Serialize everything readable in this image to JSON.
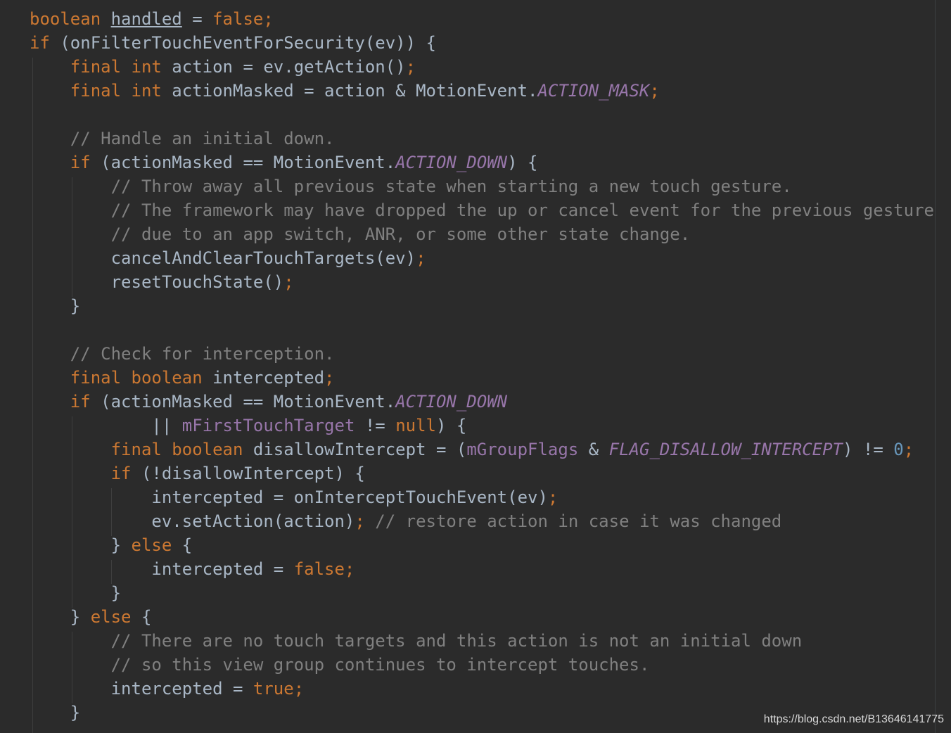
{
  "editor": {
    "background": "#2b2b2b",
    "theme_colors": {
      "keyword": "#cc7832",
      "plain": "#a9b7c6",
      "comment": "#808080",
      "constant": "#9876aa",
      "number": "#6897bb"
    },
    "lines": [
      {
        "indent": 0,
        "tokens": [
          {
            "t": "kw",
            "v": "boolean "
          },
          {
            "t": "ul",
            "v": "handled"
          },
          {
            "t": "pl",
            "v": " = "
          },
          {
            "t": "kw",
            "v": "false;"
          }
        ]
      },
      {
        "indent": 0,
        "tokens": [
          {
            "t": "kw",
            "v": "if "
          },
          {
            "t": "pl",
            "v": "(onFilterTouchEventForSecurity(ev)) {"
          }
        ]
      },
      {
        "indent": 1,
        "tokens": [
          {
            "t": "kw",
            "v": "final int "
          },
          {
            "t": "pl",
            "v": "action = ev.getAction()"
          },
          {
            "t": "kw",
            "v": ";"
          }
        ]
      },
      {
        "indent": 1,
        "tokens": [
          {
            "t": "kw",
            "v": "final int "
          },
          {
            "t": "pl",
            "v": "actionMasked = action & MotionEvent."
          },
          {
            "t": "cn",
            "v": "ACTION_MASK"
          },
          {
            "t": "kw",
            "v": ";"
          }
        ]
      },
      {
        "indent": 0,
        "tokens": []
      },
      {
        "indent": 1,
        "tokens": [
          {
            "t": "cm",
            "v": "// Handle an initial down."
          }
        ]
      },
      {
        "indent": 1,
        "tokens": [
          {
            "t": "kw",
            "v": "if "
          },
          {
            "t": "pl",
            "v": "(actionMasked == MotionEvent."
          },
          {
            "t": "cn",
            "v": "ACTION_DOWN"
          },
          {
            "t": "pl",
            "v": ") {"
          }
        ]
      },
      {
        "indent": 2,
        "tokens": [
          {
            "t": "cm",
            "v": "// Throw away all previous state when starting a new touch gesture."
          }
        ]
      },
      {
        "indent": 2,
        "tokens": [
          {
            "t": "cm",
            "v": "// The framework may have dropped the up or cancel event for the previous gesture"
          }
        ]
      },
      {
        "indent": 2,
        "tokens": [
          {
            "t": "cm",
            "v": "// due to an app switch, ANR, or some other state change."
          }
        ]
      },
      {
        "indent": 2,
        "tokens": [
          {
            "t": "pl",
            "v": "cancelAndClearTouchTargets(ev)"
          },
          {
            "t": "kw",
            "v": ";"
          }
        ]
      },
      {
        "indent": 2,
        "tokens": [
          {
            "t": "pl",
            "v": "resetTouchState()"
          },
          {
            "t": "kw",
            "v": ";"
          }
        ]
      },
      {
        "indent": 1,
        "tokens": [
          {
            "t": "pl",
            "v": "}"
          }
        ]
      },
      {
        "indent": 0,
        "tokens": []
      },
      {
        "indent": 1,
        "tokens": [
          {
            "t": "cm",
            "v": "// Check for interception."
          }
        ]
      },
      {
        "indent": 1,
        "tokens": [
          {
            "t": "kw",
            "v": "final boolean "
          },
          {
            "t": "pl",
            "v": "intercepted"
          },
          {
            "t": "kw",
            "v": ";"
          }
        ]
      },
      {
        "indent": 1,
        "tokens": [
          {
            "t": "kw",
            "v": "if "
          },
          {
            "t": "pl",
            "v": "(actionMasked == MotionEvent."
          },
          {
            "t": "cn",
            "v": "ACTION_DOWN"
          }
        ]
      },
      {
        "indent": 3,
        "tokens": [
          {
            "t": "pl",
            "v": "|| "
          },
          {
            "t": "fd",
            "v": "mFirstTouchTarget"
          },
          {
            "t": "pl",
            "v": " != "
          },
          {
            "t": "kw",
            "v": "null"
          },
          {
            "t": "pl",
            "v": ") {"
          }
        ]
      },
      {
        "indent": 2,
        "tokens": [
          {
            "t": "kw",
            "v": "final boolean "
          },
          {
            "t": "pl",
            "v": "disallowIntercept = ("
          },
          {
            "t": "fd",
            "v": "mGroupFlags"
          },
          {
            "t": "pl",
            "v": " & "
          },
          {
            "t": "cn",
            "v": "FLAG_DISALLOW_INTERCEPT"
          },
          {
            "t": "pl",
            "v": ") != "
          },
          {
            "t": "nm",
            "v": "0"
          },
          {
            "t": "kw",
            "v": ";"
          }
        ]
      },
      {
        "indent": 2,
        "tokens": [
          {
            "t": "kw",
            "v": "if "
          },
          {
            "t": "pl",
            "v": "(!disallowIntercept) {"
          }
        ]
      },
      {
        "indent": 3,
        "tokens": [
          {
            "t": "pl",
            "v": "intercepted = onInterceptTouchEvent(ev)"
          },
          {
            "t": "kw",
            "v": ";"
          }
        ]
      },
      {
        "indent": 3,
        "tokens": [
          {
            "t": "pl",
            "v": "ev.setAction(action)"
          },
          {
            "t": "kw",
            "v": "; "
          },
          {
            "t": "cm",
            "v": "// restore action in case it was changed"
          }
        ]
      },
      {
        "indent": 2,
        "tokens": [
          {
            "t": "pl",
            "v": "} "
          },
          {
            "t": "kw",
            "v": "else "
          },
          {
            "t": "pl",
            "v": "{"
          }
        ]
      },
      {
        "indent": 3,
        "tokens": [
          {
            "t": "pl",
            "v": "intercepted = "
          },
          {
            "t": "kw",
            "v": "false;"
          }
        ]
      },
      {
        "indent": 2,
        "tokens": [
          {
            "t": "pl",
            "v": "}"
          }
        ]
      },
      {
        "indent": 1,
        "tokens": [
          {
            "t": "pl",
            "v": "} "
          },
          {
            "t": "kw",
            "v": "else "
          },
          {
            "t": "pl",
            "v": "{"
          }
        ]
      },
      {
        "indent": 2,
        "tokens": [
          {
            "t": "cm",
            "v": "// There are no touch targets and this action is not an initial down"
          }
        ]
      },
      {
        "indent": 2,
        "tokens": [
          {
            "t": "cm",
            "v": "// so this view group continues to intercept touches."
          }
        ]
      },
      {
        "indent": 2,
        "tokens": [
          {
            "t": "pl",
            "v": "intercepted = "
          },
          {
            "t": "kw",
            "v": "true;"
          }
        ]
      },
      {
        "indent": 1,
        "tokens": [
          {
            "t": "pl",
            "v": "}"
          }
        ]
      }
    ]
  },
  "watermark": "https://blog.csdn.net/B13646141775"
}
